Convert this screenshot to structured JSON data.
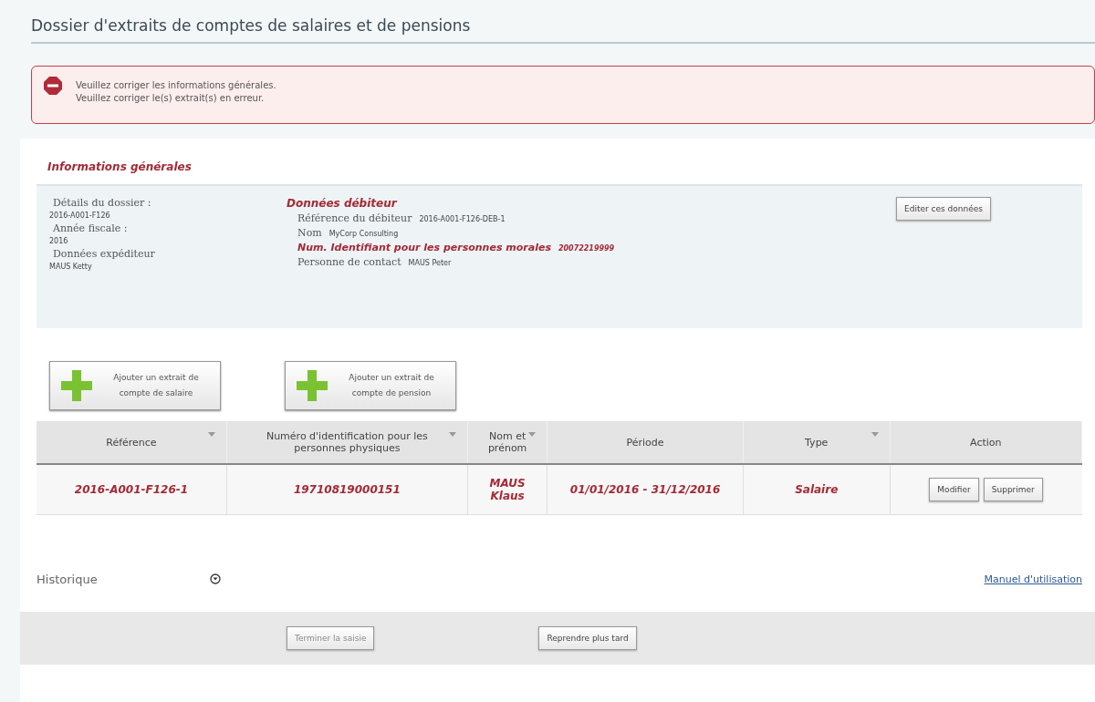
{
  "page_title": "Dossier d'extraits de comptes de salaires et de pensions",
  "errors": [
    "Veuillez corriger les informations générales.",
    "Veuillez corriger le(s) extrait(s) en erreur."
  ],
  "general_info": {
    "heading": "Informations générales",
    "left": [
      {
        "label": "Détails du dossier :",
        "value": "2016-A001-F126"
      },
      {
        "label": "Année fiscale :",
        "value": "2016"
      },
      {
        "label": "Données expéditeur",
        "value": "MAUS Ketty"
      }
    ],
    "debtor_heading": "Données débiteur",
    "debtor": [
      {
        "label": "Référence du débiteur",
        "value": "2016-A001-F126-DEB-1",
        "error": false
      },
      {
        "label": "Nom",
        "value": "MyCorp Consulting",
        "error": false
      },
      {
        "label": "Num. Identifiant pour les personnes morales",
        "value": "20072219999",
        "error": true
      },
      {
        "label": "Personne de contact",
        "value": "MAUS Peter",
        "error": false
      }
    ],
    "edit_button": "Editer ces données"
  },
  "add_buttons": [
    "Ajouter un extrait de compte de salaire",
    "Ajouter un extrait de compte de pension"
  ],
  "table": {
    "columns": [
      {
        "label": "Référence",
        "sortable": true
      },
      {
        "label": "Numéro d'identification pour les personnes physiques",
        "sortable": true
      },
      {
        "label": "Nom et prénom",
        "sortable": true
      },
      {
        "label": "Période",
        "sortable": false
      },
      {
        "label": "Type",
        "sortable": true
      },
      {
        "label": "Action",
        "sortable": false
      }
    ],
    "rows": [
      {
        "cells": [
          "2016-A001-F126-1",
          "19710819000151",
          "MAUS Klaus",
          "01/01/2016 - 31/12/2016",
          "Salaire"
        ],
        "actions": [
          "Modifier",
          "Supprimer"
        ]
      }
    ]
  },
  "history": {
    "label": "Historique",
    "expanded": false
  },
  "manual_link": "Manuel d'utilisation",
  "footer_buttons": [
    {
      "label": "Terminer la saisie",
      "disabled": true
    },
    {
      "label": "Reprendre plus tard",
      "disabled": false
    }
  ]
}
